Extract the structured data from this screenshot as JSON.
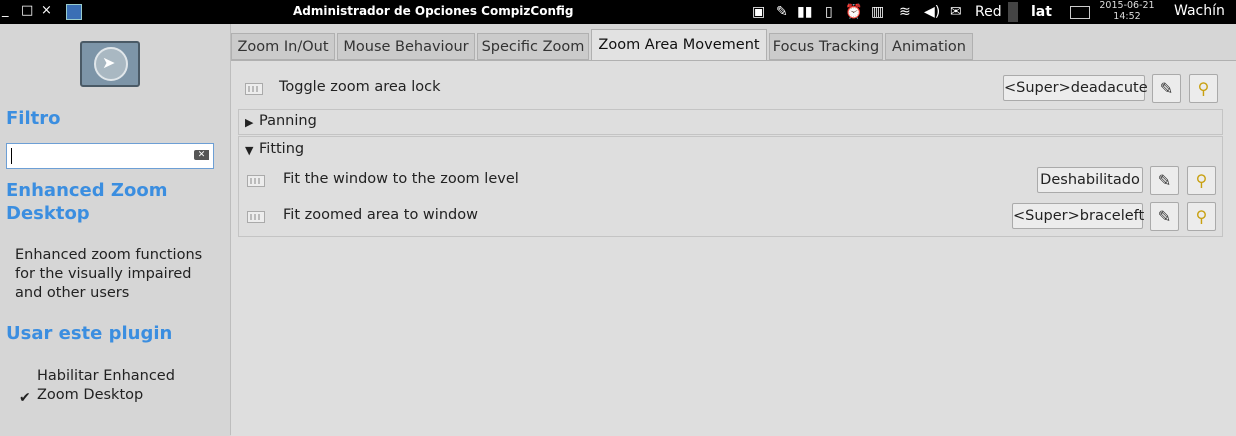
{
  "window": {
    "title": "Administrador de Opciones CompizConfig"
  },
  "window_controls": {
    "minimize": "_",
    "maximize": "□",
    "close": "×"
  },
  "tray": {
    "network_label": "Red",
    "keyboard_layout": "lat",
    "date": "2015-06-21",
    "time": "14:52",
    "user": "Wachín"
  },
  "sidebar": {
    "filter_heading": "Filtro",
    "search_value": "",
    "plugin_title": "Enhanced Zoom Desktop",
    "plugin_description": "Enhanced zoom functions for the visually impaired and other users",
    "use_heading": "Usar este plugin",
    "enable_label": "Habilitar Enhanced Zoom Desktop",
    "enable_checked": true
  },
  "tabs": [
    {
      "label": "Zoom In/Out"
    },
    {
      "label": "Mouse Behaviour"
    },
    {
      "label": "Specific Zoom"
    },
    {
      "label": "Zoom Area Movement",
      "active": true
    },
    {
      "label": "Focus Tracking"
    },
    {
      "label": "Animation"
    }
  ],
  "settings": {
    "toggle_lock": {
      "label": "Toggle zoom area lock",
      "binding": "<Super>deadacute"
    },
    "panning": {
      "label": "Panning",
      "expanded": false
    },
    "fitting": {
      "label": "Fitting",
      "expanded": true,
      "fit_window": {
        "label": "Fit the window to the zoom level",
        "binding": "Deshabilitado"
      },
      "fit_area": {
        "label": "Fit zoomed area to window",
        "binding": "<Super>braceleft"
      }
    }
  },
  "icons": {
    "edit": "✎",
    "clear": "🧹",
    "check": "✔",
    "expand": "▶",
    "collapse": "▼"
  },
  "colors": {
    "heading": "#3b8ee0",
    "background": "#d6d6d6"
  }
}
